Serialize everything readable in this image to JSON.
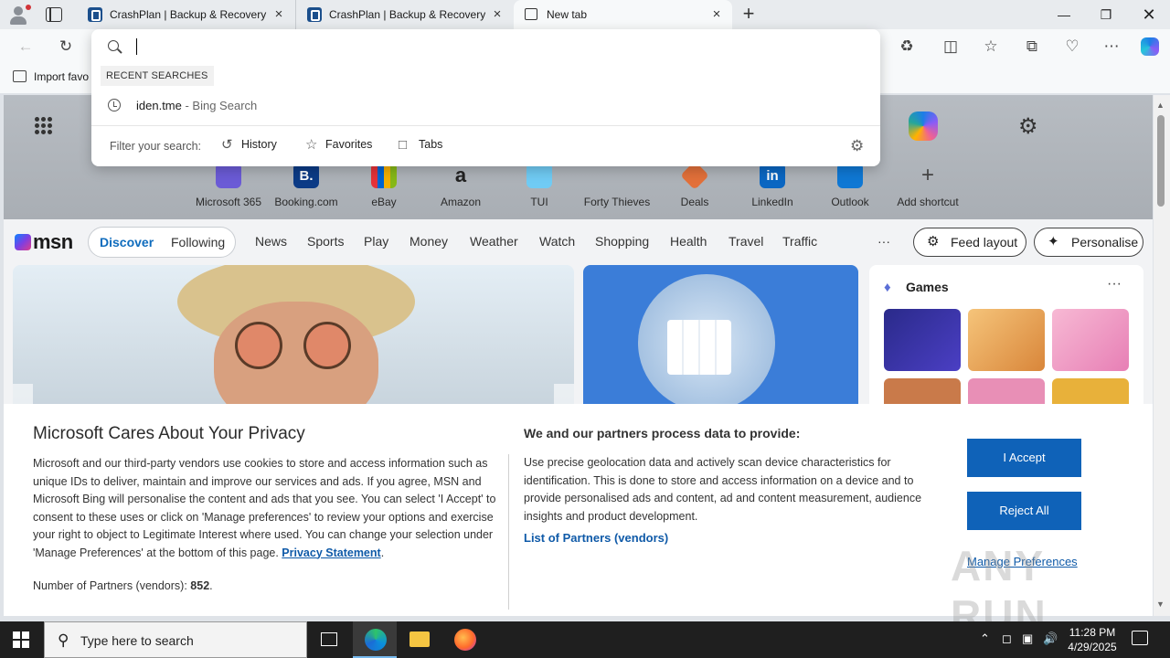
{
  "tabs": [
    {
      "title": "CrashPlan | Backup & Recovery S",
      "close": "×"
    },
    {
      "title": "CrashPlan | Backup & Recovery S",
      "close": "×"
    },
    {
      "title": "New tab",
      "close": "×"
    }
  ],
  "toolbar": {
    "favorites_bar_item": "Import favo"
  },
  "omnibox": {
    "value": "",
    "recent_label": "RECENT SEARCHES",
    "recent_items": [
      {
        "query": "iden.tme",
        "source": " - Bing Search"
      }
    ],
    "filter_label": "Filter your search:",
    "filters": [
      {
        "label": "History",
        "icon": "history-icon"
      },
      {
        "label": "Favorites",
        "icon": "star-icon"
      },
      {
        "label": "Tabs",
        "icon": "tabs-icon"
      }
    ]
  },
  "newtab": {
    "shortcuts": [
      {
        "label": "Microsoft 365",
        "glyph": "",
        "color": "#6b5bd6"
      },
      {
        "label": "Booking.com",
        "glyph": "B.",
        "color": "#0c3b86"
      },
      {
        "label": "eBay",
        "glyph": "",
        "color": "#e53238"
      },
      {
        "label": "Amazon",
        "glyph": "a",
        "color": "#222222"
      },
      {
        "label": "TUI",
        "glyph": "",
        "color": "#70cbf4"
      },
      {
        "label": "Forty Thieves",
        "glyph": "",
        "color": "#333333"
      },
      {
        "label": "Deals",
        "glyph": "",
        "color": "#e2703a"
      },
      {
        "label": "LinkedIn",
        "glyph": "in",
        "color": "#0a66c2"
      },
      {
        "label": "Outlook",
        "glyph": "",
        "color": "#0f78d4"
      },
      {
        "label": "Add shortcut",
        "glyph": "+",
        "color": "#b0b5bb"
      }
    ],
    "msn_logo": "msn",
    "feed_tabs": {
      "active": "Discover",
      "other": "Following"
    },
    "nav_links": [
      "News",
      "Sports",
      "Play",
      "Money",
      "Weather",
      "Watch",
      "Shopping",
      "Health",
      "Travel",
      "Traffic"
    ],
    "more": "···",
    "feed_layout": "Feed layout",
    "personalise": "Personalise",
    "games_title": "Games",
    "games_more": "···"
  },
  "privacy": {
    "title": "Microsoft Cares About Your Privacy",
    "body": "Microsoft and our third-party vendors use cookies to store and access information such as unique IDs to deliver, maintain and improve our services and ads. If you agree, MSN and Microsoft Bing will personalise the content and ads that you see. You can select 'I Accept' to consent to these uses or click on 'Manage preferences' to review your options and exercise your right to object to Legitimate Interest where used.  You can change your selection under 'Manage Preferences' at the bottom of this page. ",
    "privacy_link": "Privacy Statement",
    "partners_label": "Number of Partners (vendors): ",
    "partners_count": "852",
    "heading2": "We and our partners process data to provide:",
    "body2": "Use precise geolocation data and actively scan device characteristics for identification. This is done to store and access information on a device and to provide personalised ads and content, ad and content measurement, audience insights and product development.",
    "vendors_link": "List of Partners (vendors)",
    "accept": "I Accept",
    "reject": "Reject All",
    "manage": "Manage Preferences"
  },
  "watermark": "ANY RUN",
  "taskbar": {
    "search_placeholder": "Type here to search",
    "time": "11:28 PM",
    "date": "4/29/2025"
  },
  "colors": {
    "accent": "#0f62b8",
    "link": "#0f5aa8",
    "taskbar": "#1f1f1f"
  }
}
